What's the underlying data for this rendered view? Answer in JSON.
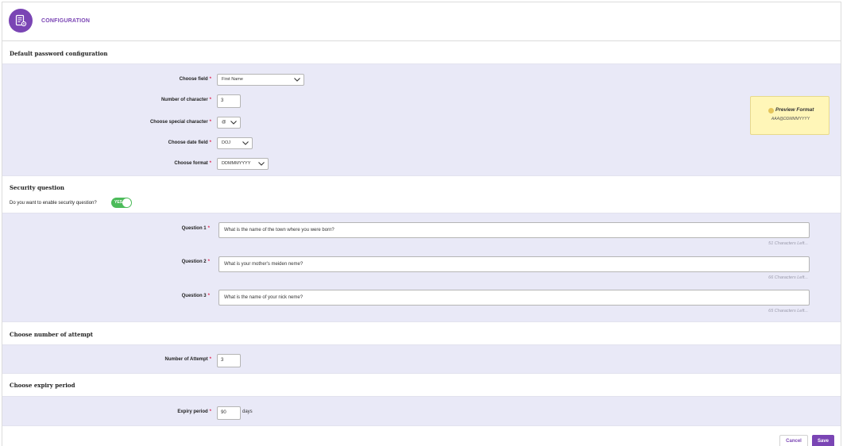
{
  "header": {
    "title": "CONFIGURATION",
    "icon": "settings-document-icon"
  },
  "password_config": {
    "section_title": "Default password configuration",
    "choose_field": {
      "label": "Choose field",
      "value": "First Name"
    },
    "num_chars": {
      "label": "Number of character",
      "value": "3"
    },
    "special_char": {
      "label": "Choose special character",
      "value": "@"
    },
    "date_field": {
      "label": "Choose date field",
      "value": "DOJ"
    },
    "format": {
      "label": "Choose format",
      "value": "DDMMMYYYY"
    },
    "preview": {
      "title": "Preview Format",
      "value": "AAA@DDMMMYYYY"
    }
  },
  "security": {
    "section_title": "Security question",
    "enable_label": "Do you want to enable security question?",
    "toggle_label": "YES",
    "enabled": true,
    "questions": [
      {
        "label": "Question 1",
        "value": "What is the name of the town where you were born?",
        "chars_left": "51 Characters Left..."
      },
      {
        "label": "Question 2",
        "value": "What is your mother's meiden neme?",
        "chars_left": "66 Characters Left..."
      },
      {
        "label": "Question 3",
        "value": "What is the name of your nick neme?",
        "chars_left": "65 Characters Left..."
      }
    ]
  },
  "attempts": {
    "section_title": "Choose number of attempt",
    "label": "Number of Attempt",
    "value": "3"
  },
  "expiry": {
    "section_title": "Choose expiry period",
    "label": "Expiry period",
    "value": "90",
    "unit": "days"
  },
  "actions": {
    "cancel": "Cancel",
    "save": "Save"
  },
  "colors": {
    "accent": "#7a45b4",
    "band": "#e9e9f7",
    "required": "#e0204f",
    "toggle_on": "#4cbb5a",
    "preview_bg": "#fff6b8"
  }
}
